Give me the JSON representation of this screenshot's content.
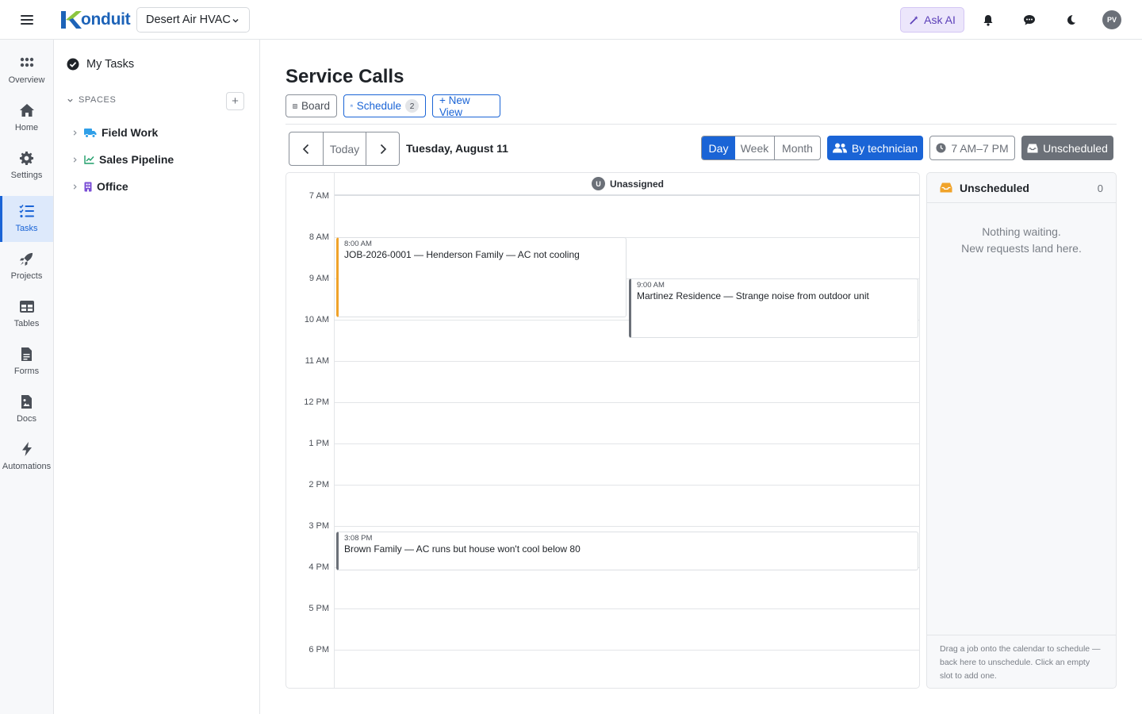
{
  "topbar": {
    "logo_text": "onduit",
    "org_name": "Desert Air HVAC",
    "ask_ai_label": "Ask AI",
    "avatar_initials": "PV"
  },
  "rail": {
    "items": [
      {
        "label": "Overview",
        "icon": "grid-dots-icon"
      },
      {
        "label": "Home",
        "icon": "home-icon"
      },
      {
        "label": "Settings",
        "icon": "gear-icon"
      },
      {
        "label": "Tasks",
        "icon": "task-list-icon",
        "active": true
      },
      {
        "label": "Projects",
        "icon": "rocket-icon"
      },
      {
        "label": "Tables",
        "icon": "table-icon"
      },
      {
        "label": "Forms",
        "icon": "form-icon"
      },
      {
        "label": "Docs",
        "icon": "doc-icon"
      },
      {
        "label": "Automations",
        "icon": "bolt-icon"
      }
    ]
  },
  "sidebar": {
    "my_tasks_label": "My Tasks",
    "spaces_heading": "SPACES",
    "spaces": [
      {
        "label": "Field Work",
        "icon": "truck-icon",
        "color": "#2f9fe8"
      },
      {
        "label": "Sales Pipeline",
        "icon": "chart-line-icon",
        "color": "#1f9e6a"
      },
      {
        "label": "Office",
        "icon": "building-icon",
        "color": "#7b4fd6"
      }
    ]
  },
  "main": {
    "title": "Service Calls",
    "view_tabs": {
      "board_label": "Board",
      "schedule_label": "Schedule",
      "schedule_count": "2",
      "new_view_label": "+ New View"
    },
    "nav": {
      "today_label": "Today",
      "date_label": "Tuesday, August 11"
    },
    "range_toggle": {
      "day_label": "Day",
      "week_label": "Week",
      "month_label": "Month",
      "selected": "Day"
    },
    "by_technician_label": "By technician",
    "hours_label": "7 AM–7 PM",
    "unscheduled_button_label": "Unscheduled"
  },
  "calendar": {
    "column": {
      "avatar": "U",
      "label": "Unassigned"
    },
    "hours": [
      "7 AM",
      "8 AM",
      "9 AM",
      "10 AM",
      "11 AM",
      "12 PM",
      "1 PM",
      "2 PM",
      "3 PM",
      "4 PM",
      "5 PM",
      "6 PM"
    ],
    "events": [
      {
        "time": "8:00 AM",
        "title": "JOB-2026-0001 — Henderson Family — AC not cooling",
        "accent": "#f0a32a"
      },
      {
        "time": "9:00 AM",
        "title": "Martinez Residence — Strange noise from outdoor unit",
        "accent": "#6b7078"
      },
      {
        "time": "3:08 PM",
        "title": "Brown Family — AC runs but house won't cool below 80",
        "accent": "#6b7078"
      }
    ]
  },
  "unscheduled_panel": {
    "title": "Unscheduled",
    "count": "0",
    "empty_line1": "Nothing waiting.",
    "empty_line2": "New requests land here.",
    "footer_text": "Drag a job onto the calendar to schedule — back here to unschedule. Click an empty slot to add one."
  },
  "colors": {
    "primary": "#1a64d6",
    "accent_orange": "#f0a32a",
    "ask_ai_bg": "#ece6fb",
    "ask_ai_text": "#5b3fb8"
  }
}
